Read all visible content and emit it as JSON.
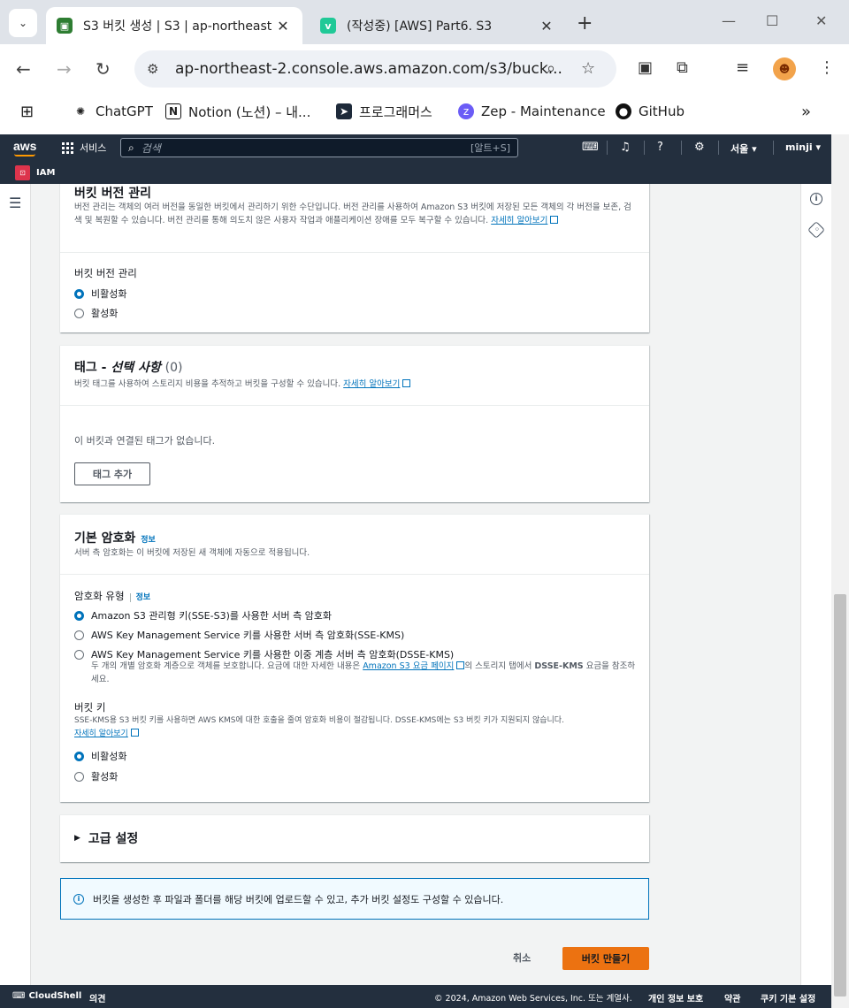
{
  "browser": {
    "tabs": [
      {
        "title": "S3 버킷 생성 | S3 | ap-northeast",
        "active": true,
        "favicon_color": "#2e7d32"
      },
      {
        "title": "(작성중) [AWS] Part6. S3",
        "active": false,
        "favicon_color": "#20c997"
      }
    ],
    "url": "ap-northeast-2.console.aws.amazon.com/s3/buck...",
    "bookmarks": [
      {
        "label": "ChatGPT",
        "icon": "chatgpt-icon"
      },
      {
        "label": "Notion (노션) – 내...",
        "icon": "notion-icon"
      },
      {
        "label": "프로그래머스",
        "icon": "programmers-icon"
      },
      {
        "label": "Zep - Maintenance",
        "icon": "zep-icon"
      },
      {
        "label": "GitHub",
        "icon": "github-icon"
      }
    ]
  },
  "aws": {
    "logo": "aws",
    "services_label": "서비스",
    "search_placeholder": "검색",
    "search_shortcut": "[알트+S]",
    "region": "서울",
    "user": "minji",
    "iam_label": "IAM"
  },
  "versioning": {
    "title": "버킷 버전 관리",
    "description": "버전 관리는 객체의 여러 버전을 동일한 버킷에서 관리하기 위한 수단입니다. 버전 관리를 사용하여 Amazon S3 버킷에 저장된 모든 객체의 각 버전을 보존, 검색 및 복원할 수 있습니다. 버전 관리를 통해 의도치 않은 사용자 작업과 애플리케이션 장애를 모두 복구할 수 있습니다.",
    "learn_more": "자세히 알아보기",
    "field_label": "버킷 버전 관리",
    "options": [
      "비활성화",
      "활성화"
    ],
    "selected": "비활성화"
  },
  "tags": {
    "title": "태그 - ",
    "title_optional": "선택 사항",
    "count": "(0)",
    "description": "버킷 태그를 사용하여 스토리지 비용을 추적하고 버킷을 구성할 수 있습니다.",
    "learn_more": "자세히 알아보기",
    "empty_text": "이 버킷과 연결된 태그가 없습니다.",
    "add_button": "태그 추가"
  },
  "encryption": {
    "title": "기본 암호화",
    "info": "정보",
    "description": "서버 측 암호화는 이 버킷에 저장된 새 객체에 자동으로 적용됩니다.",
    "type_label": "암호화 유형",
    "type_info": "정보",
    "options": [
      "Amazon S3 관리형 키(SSE-S3)를 사용한 서버 측 암호화",
      "AWS Key Management Service 키를 사용한 서버 측 암호화(SSE-KMS)",
      "AWS Key Management Service 키를 사용한 이중 계층 서버 측 암호화(DSSE-KMS)"
    ],
    "selected": "Amazon S3 관리형 키(SSE-S3)를 사용한 서버 측 암호화",
    "dsse_desc_1": "두 개의 개별 암호화 계층으로 객체를 보호합니다. 요금에 대한 자세한 내용은 ",
    "dsse_link": "Amazon S3 요금 페이지",
    "dsse_desc_2": "의 스토리지 탭에서 ",
    "dsse_bold": "DSSE-KMS",
    "dsse_desc_3": " 요금을 참조하세요.",
    "bucket_key_label": "버킷 키",
    "bucket_key_desc": "SSE-KMS용 S3 버킷 키를 사용하면 AWS KMS에 대한 호출을 줄여 암호화 비용이 절감됩니다. DSSE-KMS에는 S3 버킷 키가 지원되지 않습니다.",
    "bucket_key_learn_more": "자세히 알아보기",
    "bucket_key_options": [
      "비활성화",
      "활성화"
    ],
    "bucket_key_selected": "비활성화"
  },
  "advanced": {
    "title": "고급 설정"
  },
  "alert": {
    "text": "버킷을 생성한 후 파일과 폴더를 해당 버킷에 업로드할 수 있고, 추가 버킷 설정도 구성할 수 있습니다."
  },
  "actions": {
    "cancel": "취소",
    "create": "버킷 만들기"
  },
  "footer": {
    "cloudshell": "CloudShell",
    "feedback": "의견",
    "copyright": "© 2024, Amazon Web Services, Inc. 또는 계열사.",
    "privacy": "개인 정보 보호",
    "terms": "약관",
    "cookies": "쿠키 기본 설정"
  },
  "colors": {
    "aws_nav": "#232f3e",
    "primary_button": "#ec7211",
    "link": "#0073bb"
  }
}
